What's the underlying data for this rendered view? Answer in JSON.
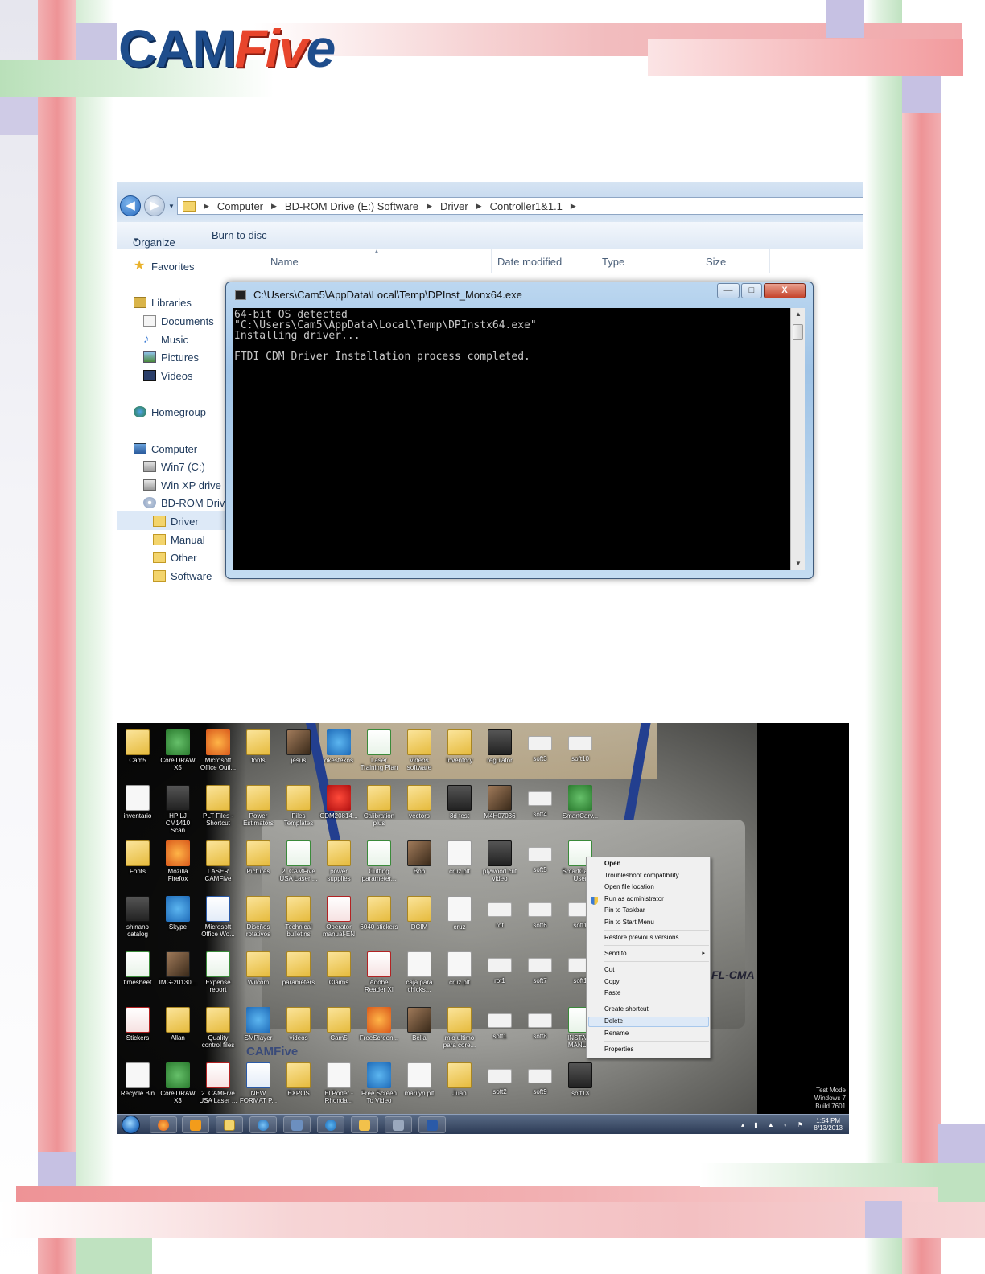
{
  "logo": {
    "cam": "CAM",
    "five": "Fiv",
    "e": "e"
  },
  "explorer": {
    "breadcrumb": [
      "Computer",
      "BD-ROM Drive (E:) Software",
      "Driver",
      "Controller1&1.1"
    ],
    "toolbar": {
      "organize": "Organize",
      "burn": "Burn to disc"
    },
    "columns": [
      "Name",
      "Date modified",
      "Type",
      "Size"
    ],
    "nav": {
      "favorites": "Favorites",
      "libraries": "Libraries",
      "documents": "Documents",
      "music": "Music",
      "pictures": "Pictures",
      "videos": "Videos",
      "homegroup": "Homegroup",
      "computer": "Computer",
      "win7": "Win7 (C:)",
      "winxp": "Win XP drive (",
      "bdrom": "BD-ROM Drive",
      "driver": "Driver",
      "manual": "Manual",
      "other": "Other",
      "software": "Software"
    }
  },
  "console": {
    "title": "C:\\Users\\Cam5\\AppData\\Local\\Temp\\DPInst_Monx64.exe",
    "minimize": "—",
    "maximize": "□",
    "close": "X",
    "output": "64-bit OS detected\n\"C:\\Users\\Cam5\\AppData\\Local\\Temp\\DPInstx64.exe\"\nInstalling driver...\n\nFTDI CDM Driver Installation process completed."
  },
  "desktop": {
    "icons": {
      "r1": [
        "Cam5",
        "CorelDRAW X5",
        "Microsoft Office Outl...",
        "fonts",
        "jesus",
        "okestekos",
        "Laser Training Plan",
        "videos software",
        "Inventory",
        "regulator",
        "soft3",
        "soft10"
      ],
      "r2": [
        "inventario",
        "HP LJ CM1410 Scan",
        "PLT Files - Shortcut",
        "Power Estimators",
        "Files Templates",
        "CDM20814...",
        "Calibration plus",
        "vectors",
        "3d test",
        "M4H07036",
        "soft4",
        "SmartCarv..."
      ],
      "r3": [
        "Fonts",
        "Mozilla Firefox",
        "LASER CAMFive",
        "Pictures",
        "2. CAMFive USA Laser ...",
        "power supplies",
        "Cutting parameter...",
        "Bob",
        "cruz.plt",
        "plywood cut video",
        "soft5",
        "SmartCa... 3 User"
      ],
      "r4": [
        "shinano catalog",
        "Skype",
        "Microsoft Office Wo...",
        "Diseños rotativos",
        "Technical bulletins",
        "Operator manual-EN",
        "6040 stickers",
        "DCIM",
        "cruz",
        "rot",
        "soft6",
        "soft1"
      ],
      "r5": [
        "timesheet",
        "IMG-20130...",
        "Expense report",
        "Wilcom",
        "parameters",
        "Claims",
        "Adobe Reader XI",
        "caja para chicks...",
        "cruz.plt",
        "rot1",
        "soft7",
        "soft1"
      ],
      "r6": [
        "Stickers",
        "Allan",
        "Quality control files",
        "SMPlayer",
        "videos",
        "Cam5",
        "FreeScreen...",
        "Bella",
        "mio ultimo para core...",
        "soft1",
        "soft8",
        "INSTALL MANU..."
      ],
      "r7": [
        "Recycle Bin",
        "CorelDRAW X3",
        "2. CAMFive USA Laser ...",
        "NEW FORMAT P...",
        "EXPOS",
        "El Poder - Rhonda...",
        "Free Screen To Video",
        "marilyn.plt",
        "Juan",
        "soft2",
        "soft9",
        "soft13"
      ]
    },
    "context_menu": {
      "open": "Open",
      "troubleshoot": "Troubleshoot compatibility",
      "open_location": "Open file location",
      "run_admin": "Run as administrator",
      "pin_taskbar": "Pin to Taskbar",
      "pin_start": "Pin to Start Menu",
      "restore": "Restore previous versions",
      "send_to": "Send to",
      "cut": "Cut",
      "copy": "Copy",
      "paste": "Paste",
      "create_shortcut": "Create shortcut",
      "delete": "Delete",
      "rename": "Rename",
      "properties": "Properties",
      "submenu_arrow": "▸"
    },
    "wallpaper": {
      "machine_label": "FL-CMA",
      "logo": "CAMFive"
    },
    "watermark": {
      "line1": "Test Mode",
      "line2": "Windows 7",
      "line3": "Build 7601"
    },
    "clock": {
      "time": "1:54 PM",
      "date": "8/13/2013"
    }
  }
}
